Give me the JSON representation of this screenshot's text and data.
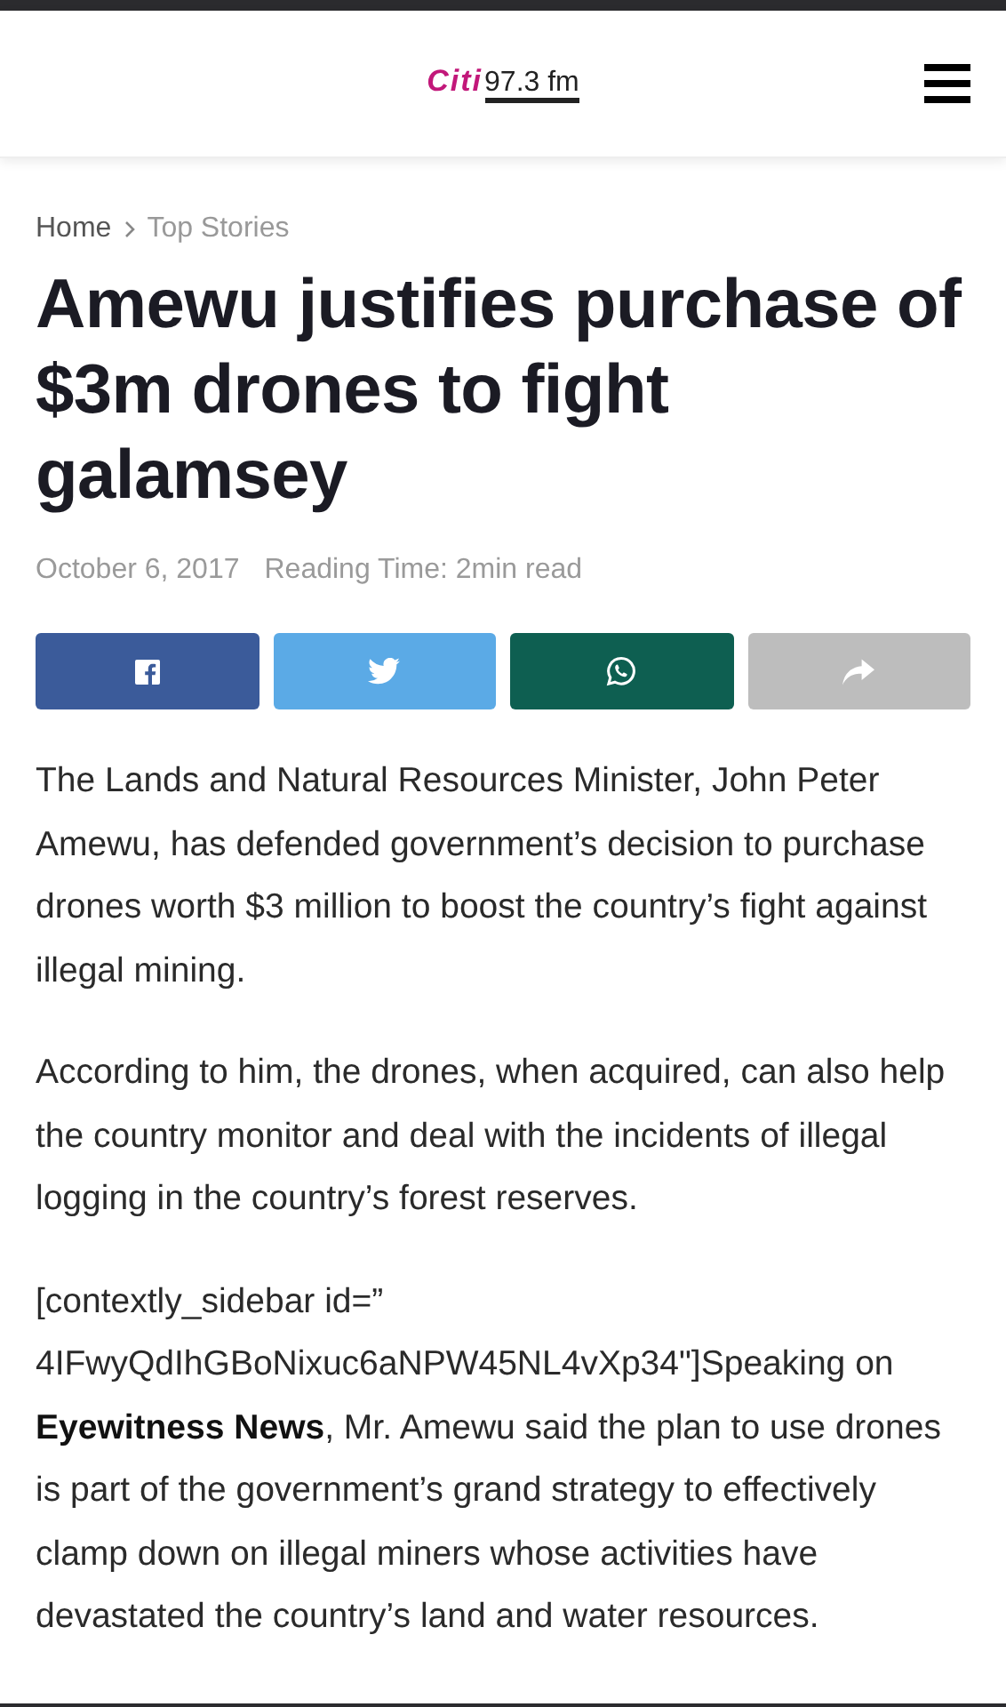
{
  "header": {
    "logo": {
      "brand": "Citi",
      "frequency": "97.3 fm"
    }
  },
  "breadcrumb": [
    {
      "label": "Home",
      "kind": "home"
    },
    {
      "label": "Top Stories",
      "kind": "current"
    }
  ],
  "article": {
    "title": "Amewu justifies purchase of $3m drones to fight galamsey",
    "date": "October 6, 2017",
    "reading_time": "Reading Time: 2min read",
    "share_buttons": [
      {
        "kind": "facebook"
      },
      {
        "kind": "twitter"
      },
      {
        "kind": "whatsapp"
      },
      {
        "kind": "share"
      }
    ],
    "paragraphs": [
      "The Lands and Natural Resources Minister, John Peter Amewu, has defended government’s decision to purchase drones worth $3 million to boost the country’s fight against illegal mining.",
      "According to him, the drones, when acquired, can also help the country monitor and deal with the incidents of illegal logging in the country’s forest reserves.",
      "[contextly_sidebar id=” 4IFwyQdIhGBoNixuc6aNPW45NL4vXp34\"]Speaking on **Eyewitness News**, Mr. Amewu said the plan to use drones is part of the government’s grand strategy to effectively clamp down on illegal miners whose activities have devastated the country’s land and water resources."
    ]
  }
}
